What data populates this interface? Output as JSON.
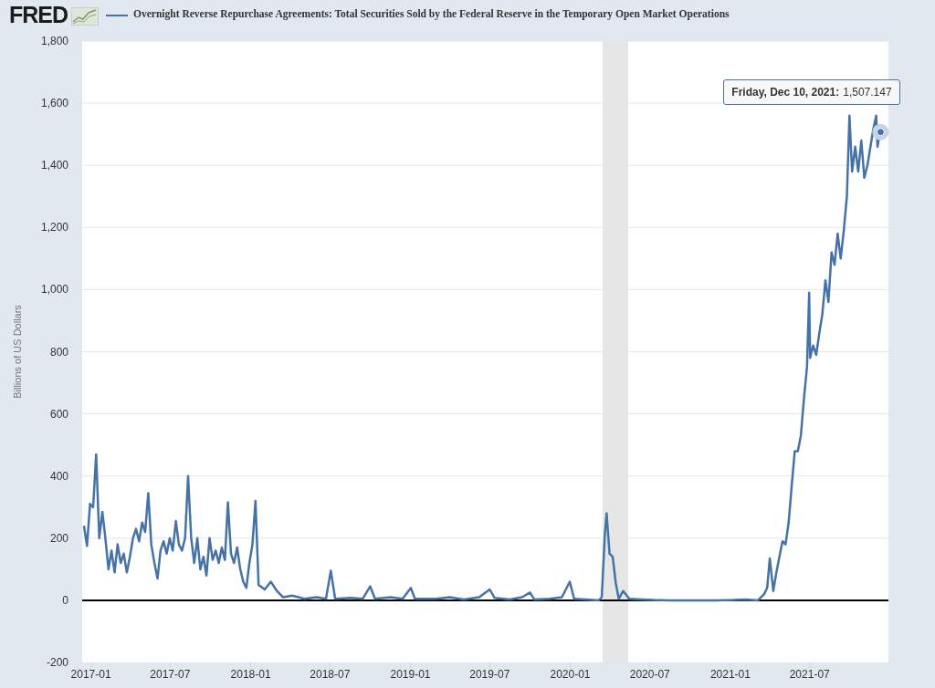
{
  "header": {
    "logo": "FRED"
  },
  "chart": {
    "chart_data": {
      "type": "line",
      "ylabel": "Billions of US Dollars",
      "xlim": [
        "2016-12-12",
        "2021-12-28"
      ],
      "ylim": [
        -200,
        1800
      ],
      "yticks": [
        {
          "value": -200,
          "label": "-200"
        },
        {
          "value": 0,
          "label": "0"
        },
        {
          "value": 200,
          "label": "200"
        },
        {
          "value": 400,
          "label": "400"
        },
        {
          "value": 600,
          "label": "600"
        },
        {
          "value": 800,
          "label": "800"
        },
        {
          "value": 1000,
          "label": "1,000"
        },
        {
          "value": 1200,
          "label": "1,200"
        },
        {
          "value": 1400,
          "label": "1,400"
        },
        {
          "value": 1600,
          "label": "1,600"
        },
        {
          "value": 1800,
          "label": "1,800"
        }
      ],
      "xticks": [
        {
          "value": "2017-01-01",
          "label": "2017-01"
        },
        {
          "value": "2017-07-01",
          "label": "2017-07"
        },
        {
          "value": "2018-01-01",
          "label": "2018-01"
        },
        {
          "value": "2018-07-01",
          "label": "2018-07"
        },
        {
          "value": "2019-01-01",
          "label": "2019-01"
        },
        {
          "value": "2019-07-01",
          "label": "2019-07"
        },
        {
          "value": "2020-01-01",
          "label": "2020-01"
        },
        {
          "value": "2020-07-01",
          "label": "2020-07"
        },
        {
          "value": "2021-01-01",
          "label": "2021-01"
        },
        {
          "value": "2021-07-01",
          "label": "2021-07"
        }
      ],
      "x": [
        "2016-12-16",
        "2016-12-23",
        "2016-12-30",
        "2017-01-06",
        "2017-01-13",
        "2017-01-20",
        "2017-01-27",
        "2017-02-03",
        "2017-02-10",
        "2017-02-17",
        "2017-02-24",
        "2017-03-03",
        "2017-03-10",
        "2017-03-17",
        "2017-03-24",
        "2017-03-31",
        "2017-04-07",
        "2017-04-14",
        "2017-04-21",
        "2017-04-28",
        "2017-05-05",
        "2017-05-12",
        "2017-05-19",
        "2017-05-26",
        "2017-06-02",
        "2017-06-09",
        "2017-06-16",
        "2017-06-23",
        "2017-06-30",
        "2017-07-07",
        "2017-07-14",
        "2017-07-21",
        "2017-07-28",
        "2017-08-04",
        "2017-08-11",
        "2017-08-18",
        "2017-08-25",
        "2017-09-01",
        "2017-09-08",
        "2017-09-15",
        "2017-09-22",
        "2017-09-29",
        "2017-10-06",
        "2017-10-13",
        "2017-10-20",
        "2017-10-27",
        "2017-11-03",
        "2017-11-10",
        "2017-11-17",
        "2017-11-24",
        "2017-12-01",
        "2017-12-08",
        "2017-12-15",
        "2017-12-22",
        "2017-12-29",
        "2018-01-05",
        "2018-01-12",
        "2018-01-19",
        "2018-02-02",
        "2018-02-16",
        "2018-03-02",
        "2018-03-16",
        "2018-04-06",
        "2018-05-04",
        "2018-06-01",
        "2018-06-22",
        "2018-07-03",
        "2018-07-13",
        "2018-08-17",
        "2018-09-14",
        "2018-10-01",
        "2018-10-12",
        "2018-11-16",
        "2018-12-14",
        "2019-01-02",
        "2019-01-11",
        "2019-03-01",
        "2019-04-01",
        "2019-05-03",
        "2019-06-07",
        "2019-07-01",
        "2019-07-12",
        "2019-08-16",
        "2019-09-13",
        "2019-10-01",
        "2019-10-11",
        "2019-11-15",
        "2019-12-13",
        "2019-12-31",
        "2020-01-10",
        "2020-02-14",
        "2020-03-06",
        "2020-03-13",
        "2020-03-20",
        "2020-03-24",
        "2020-03-31",
        "2020-04-07",
        "2020-04-14",
        "2020-04-21",
        "2020-05-01",
        "2020-05-15",
        "2020-06-12",
        "2020-07-10",
        "2020-08-14",
        "2020-10-01",
        "2020-12-01",
        "2021-01-08",
        "2021-02-05",
        "2021-03-05",
        "2021-03-19",
        "2021-03-26",
        "2021-04-01",
        "2021-04-09",
        "2021-04-16",
        "2021-04-23",
        "2021-04-30",
        "2021-05-07",
        "2021-05-14",
        "2021-05-21",
        "2021-05-28",
        "2021-06-04",
        "2021-06-11",
        "2021-06-18",
        "2021-06-25",
        "2021-06-30",
        "2021-07-02",
        "2021-07-09",
        "2021-07-16",
        "2021-07-23",
        "2021-07-30",
        "2021-08-06",
        "2021-08-13",
        "2021-08-20",
        "2021-08-27",
        "2021-09-03",
        "2021-09-10",
        "2021-09-17",
        "2021-09-24",
        "2021-09-30",
        "2021-10-06",
        "2021-10-13",
        "2021-10-20",
        "2021-10-27",
        "2021-11-03",
        "2021-11-10",
        "2021-11-17",
        "2021-11-24",
        "2021-11-30",
        "2021-12-03",
        "2021-12-08",
        "2021-12-10"
      ],
      "series": [
        {
          "name": "Overnight Reverse Repurchase Agreements: Total Securities Sold by the Federal Reserve in the Temporary Open Market Operations",
          "color": "#4572a7",
          "values": [
            240,
            175,
            310,
            300,
            470,
            200,
            285,
            200,
            100,
            160,
            90,
            180,
            120,
            150,
            90,
            140,
            200,
            230,
            190,
            250,
            220,
            345,
            180,
            120,
            70,
            160,
            190,
            150,
            200,
            160,
            255,
            180,
            160,
            200,
            400,
            200,
            120,
            200,
            100,
            140,
            80,
            200,
            130,
            160,
            120,
            170,
            130,
            315,
            150,
            120,
            170,
            100,
            60,
            40,
            120,
            180,
            320,
            50,
            35,
            60,
            30,
            10,
            15,
            5,
            10,
            5,
            95,
            5,
            8,
            5,
            45,
            5,
            10,
            5,
            40,
            5,
            5,
            10,
            3,
            10,
            35,
            8,
            3,
            10,
            25,
            3,
            5,
            10,
            60,
            5,
            2,
            0,
            10,
            210,
            280,
            150,
            140,
            55,
            5,
            30,
            5,
            3,
            1,
            0,
            0,
            0,
            1,
            3,
            0,
            20,
            40,
            135,
            30,
            90,
            140,
            190,
            180,
            250,
            370,
            480,
            480,
            530,
            650,
            750,
            990,
            780,
            820,
            790,
            860,
            920,
            1030,
            960,
            1120,
            1080,
            1180,
            1100,
            1190,
            1300,
            1560,
            1380,
            1460,
            1380,
            1480,
            1360,
            1400,
            1460,
            1520,
            1560,
            1460,
            1500,
            1507.147
          ]
        }
      ],
      "grid": true
    },
    "tooltip": {
      "date": "Friday, Dec 10, 2021:",
      "value": "1,507.147"
    }
  }
}
